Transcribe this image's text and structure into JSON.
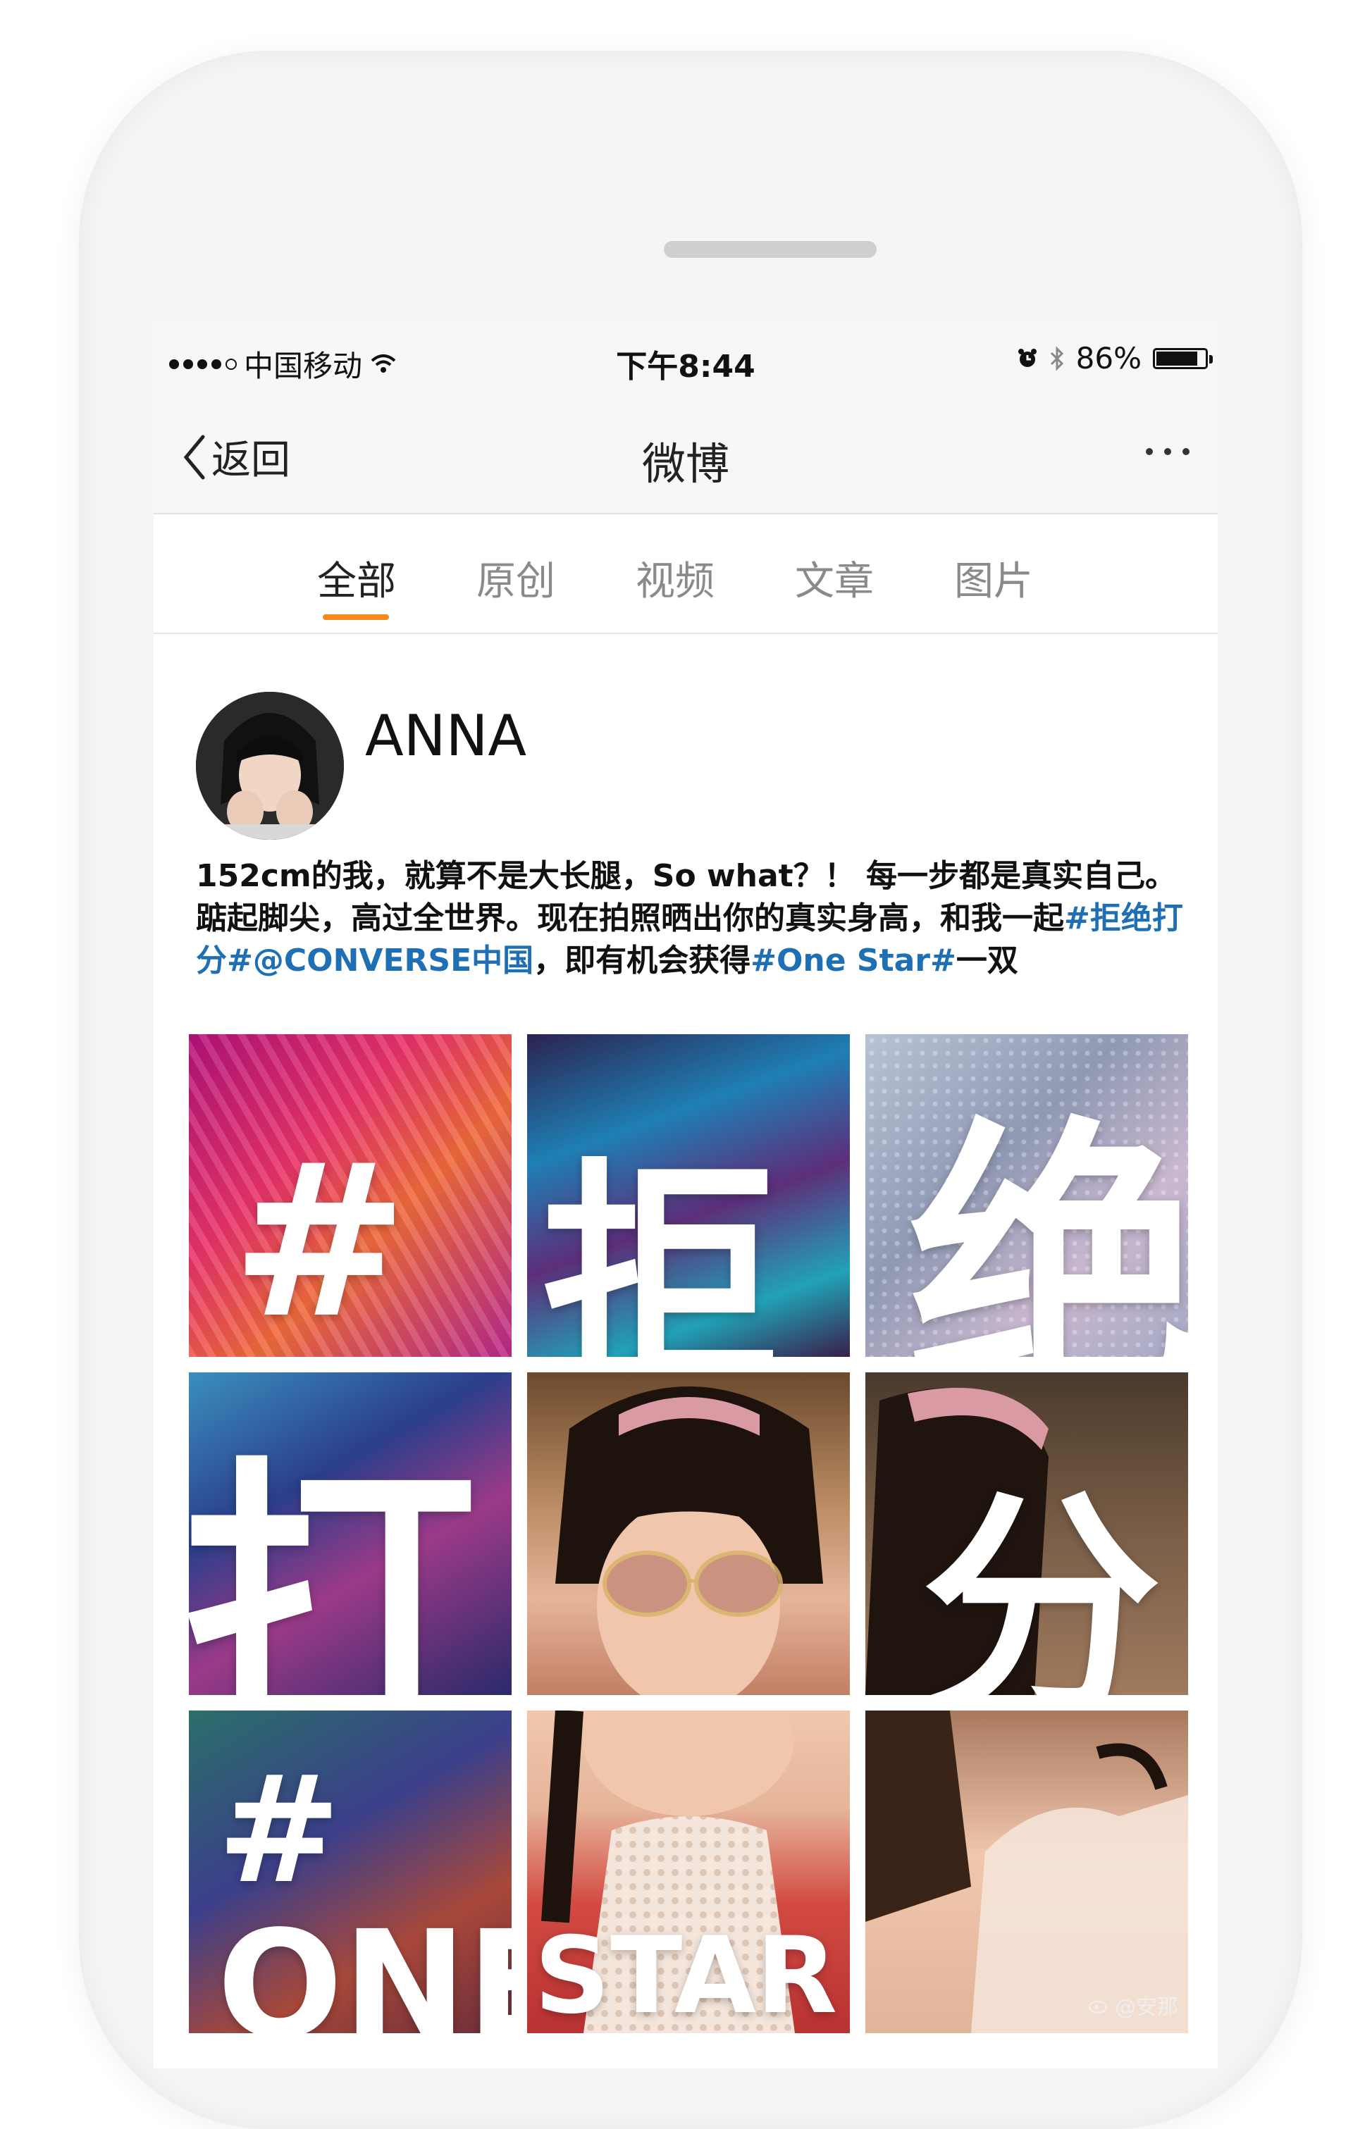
{
  "status_bar": {
    "carrier": "中国移动",
    "time": "下午8:44",
    "battery_percent": "86%",
    "battery_level": 0.86,
    "signal_bars_filled": 4,
    "signal_bars_total": 5
  },
  "nav": {
    "back_label": "返回",
    "title": "微博"
  },
  "tabs": {
    "items": [
      {
        "label": "全部",
        "active": true
      },
      {
        "label": "原创",
        "active": false
      },
      {
        "label": "视频",
        "active": false
      },
      {
        "label": "文章",
        "active": false
      },
      {
        "label": "图片",
        "active": false
      }
    ],
    "accent_color": "#f28a1e"
  },
  "post": {
    "username": "ANNA",
    "text_segments": [
      {
        "text": "152cm的我，就算不是大长腿，So what？！ 每一步都是真实自己。踮起脚尖，高过全世界。现在拍照晒出你的真实身高，和我一起",
        "link": false
      },
      {
        "text": "#拒绝打分#",
        "link": true
      },
      {
        "text": "@CONVERSE中国",
        "link": true
      },
      {
        "text": "，即有机会获得",
        "link": false
      },
      {
        "text": "#One Star#",
        "link": true
      },
      {
        "text": "一双",
        "link": false
      }
    ],
    "link_color": "#1f6fb5",
    "images": [
      {
        "glyph": "#"
      },
      {
        "glyph": "拒"
      },
      {
        "glyph": "绝"
      },
      {
        "glyph": "打"
      },
      {
        "glyph": ""
      },
      {
        "glyph": "分"
      },
      {
        "glyph": "#\nONE"
      },
      {
        "glyph": "STAR"
      },
      {
        "glyph": ""
      }
    ],
    "watermark": "@安那"
  }
}
